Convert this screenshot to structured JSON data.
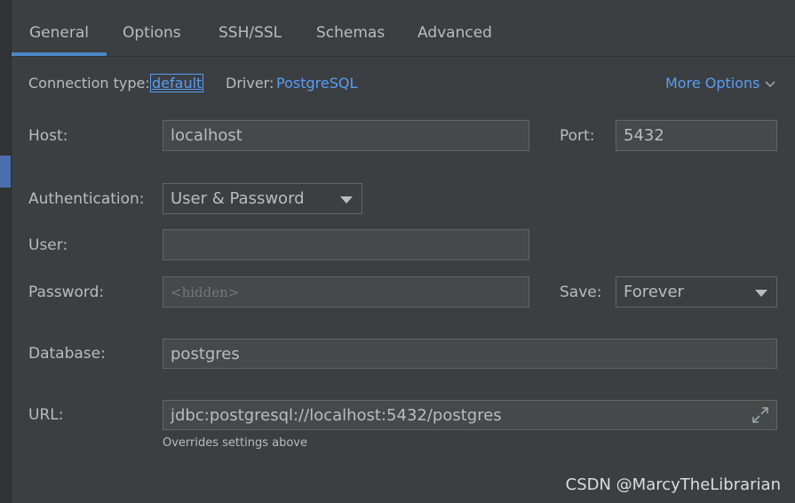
{
  "tabs": [
    {
      "label": "General",
      "active": true
    },
    {
      "label": "Options",
      "active": false
    },
    {
      "label": "SSH/SSL",
      "active": false
    },
    {
      "label": "Schemas",
      "active": false
    },
    {
      "label": "Advanced",
      "active": false
    }
  ],
  "connection": {
    "type_label": "Connection type:",
    "type_value": "default",
    "driver_label": "Driver:",
    "driver_value": "PostgreSQL",
    "more_options": "More Options"
  },
  "form": {
    "host_label": "Host:",
    "host_value": "localhost",
    "port_label": "Port:",
    "port_value": "5432",
    "auth_label": "Authentication:",
    "auth_value": "User & Password",
    "user_label": "User:",
    "user_value": "",
    "password_label": "Password:",
    "password_placeholder": "<hidden>",
    "save_label": "Save:",
    "save_value": "Forever",
    "database_label": "Database:",
    "database_value": "postgres",
    "url_label": "URL:",
    "url_value": "jdbc:postgresql://localhost:5432/postgres",
    "url_hint": "Overrides settings above"
  },
  "watermark": "CSDN @MarcyTheLibrarian",
  "colors": {
    "background": "#3c3f41",
    "accent": "#4a88c7",
    "link": "#589df6",
    "text": "#bbbbbb"
  }
}
